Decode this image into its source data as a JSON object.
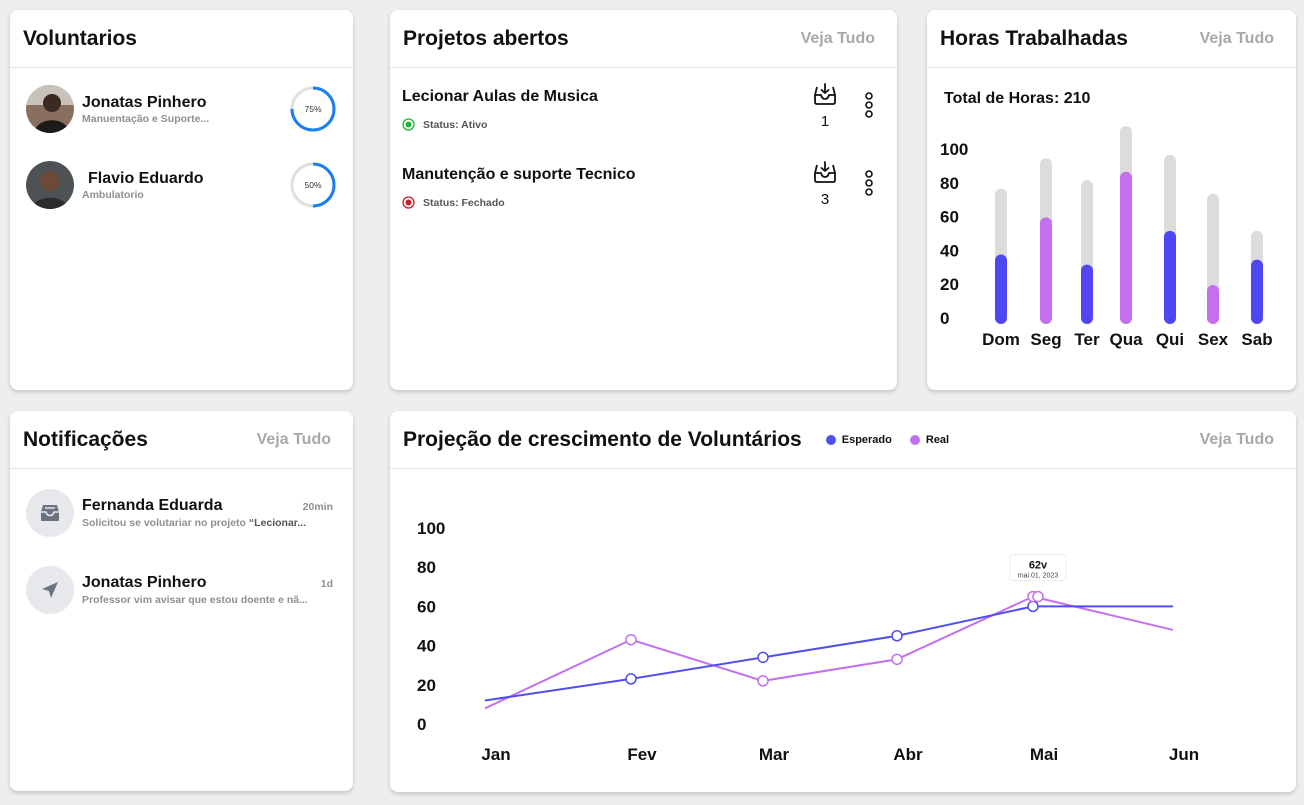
{
  "voluntarios": {
    "title": "Voluntarios",
    "items": [
      {
        "name": "Jonatas Pinhero",
        "subtitle": "Manuentação e Suporte...",
        "progress_label": "75%",
        "progress": 0.75
      },
      {
        "name": "Flavio Eduardo",
        "subtitle": "Ambulatorio",
        "progress_label": "50%",
        "progress": 0.5
      }
    ]
  },
  "projetos": {
    "title": "Projetos abertos",
    "see_all": "Veja Tudo",
    "items": [
      {
        "name": "Lecionar Aulas de Musica",
        "status": "Status: Ativo",
        "status_color": "#1fb33a",
        "count": "1"
      },
      {
        "name": "Manutenção e suporte Tecnico",
        "status": "Status: Fechado",
        "status_color": "#c8202a",
        "count": "3"
      }
    ]
  },
  "horas": {
    "title": "Horas Trabalhadas",
    "see_all": "Veja Tudo",
    "total_label": "Total de Horas: 210"
  },
  "notificacoes": {
    "title": "Notificações",
    "see_all": "Veja Tudo",
    "items": [
      {
        "name": "Fernanda Eduarda",
        "time": "20min",
        "message": "Solicitou se volutariar no projeto ",
        "message_highlight": "“Lecionar...",
        "icon": "inbox-icon"
      },
      {
        "name": "Jonatas Pinhero",
        "time": "1d",
        "message": "Professor vim avisar que estou doente e nã...",
        "message_highlight": "",
        "icon": "send-icon"
      }
    ]
  },
  "projecao": {
    "title": "Projeção de crescimento de Voluntários",
    "see_all": "Veja Tudo",
    "legend": [
      {
        "label": "Esperado",
        "color": "#4f4ff0"
      },
      {
        "label": "Real",
        "color": "#c470ee"
      }
    ],
    "tooltip": {
      "value": "62v",
      "date": "mai 01, 2023"
    }
  },
  "chart_data": [
    {
      "type": "bar",
      "title": "",
      "categories": [
        "Dom",
        "Seg",
        "Ter",
        "Qua",
        "Qui",
        "Sex",
        "Sab"
      ],
      "yticks": [
        "100",
        "80",
        "60",
        "40",
        "20",
        "0"
      ],
      "ylim": [
        0,
        100
      ],
      "series": [
        {
          "values": [
            34,
            56,
            28,
            83,
            48,
            16,
            31
          ],
          "colors": [
            "#5046f4",
            "#c470ee",
            "#5046f4",
            "#c470ee",
            "#5046f4",
            "#c470ee",
            "#5046f4"
          ]
        }
      ],
      "background_values": [
        73,
        91,
        78,
        110,
        93,
        70,
        48
      ],
      "background_color": "#dcdcdc"
    },
    {
      "type": "line",
      "title": "",
      "categories": [
        "Jan",
        "Fev",
        "Mar",
        "Abr",
        "Mai",
        "Jun"
      ],
      "yticks": [
        "100",
        "80",
        "60",
        "40",
        "20",
        "0"
      ],
      "ylim": [
        0,
        100
      ],
      "series": [
        {
          "name": "Esperado",
          "color": "#4f4ff0",
          "values": [
            12,
            23,
            34,
            45,
            60,
            60
          ]
        },
        {
          "name": "Real",
          "color": "#c470ee",
          "values": [
            8,
            43,
            22,
            33,
            65,
            48
          ]
        }
      ],
      "markers": {
        "Esperado": [
          1,
          2,
          3,
          4
        ],
        "Real": [
          1,
          2,
          3,
          4
        ]
      }
    }
  ]
}
